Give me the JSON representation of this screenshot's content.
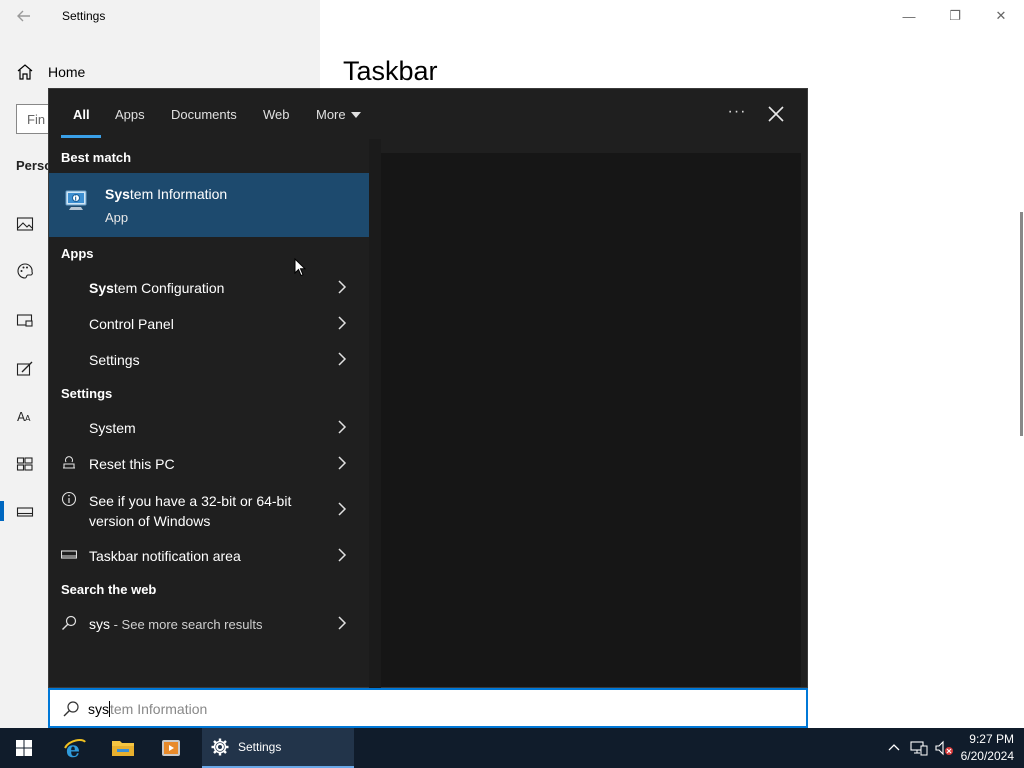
{
  "window": {
    "title": "Settings",
    "back_icon": "back-arrow-icon",
    "controls": {
      "minimize": "—",
      "maximize": "❐",
      "close": "✕"
    }
  },
  "sidebar": {
    "home_label": "Home",
    "find_placeholder": "Fin",
    "section_label": "Perso",
    "icons": [
      "picture-icon",
      "palette-icon",
      "lock-screen-icon",
      "themes-icon",
      "font-icon",
      "start-icon",
      "taskbar-icon"
    ]
  },
  "main": {
    "heading": "Taskbar"
  },
  "search": {
    "tabs": [
      {
        "label": "All",
        "active": true
      },
      {
        "label": "Apps"
      },
      {
        "label": "Documents"
      },
      {
        "label": "Web"
      },
      {
        "label": "More"
      }
    ],
    "more_options": "···",
    "best_match_header": "Best match",
    "best_match": {
      "title_bold": "Sys",
      "title_rest": "tem Information",
      "subtitle": "App"
    },
    "apps_header": "Apps",
    "apps": [
      {
        "bold": "Sys",
        "rest": "tem Configuration"
      },
      {
        "bold": "",
        "rest": "Control Panel"
      },
      {
        "bold": "",
        "rest": "Settings"
      }
    ],
    "settings_header": "Settings",
    "settings": [
      {
        "label": "System",
        "icon": ""
      },
      {
        "label": "Reset this PC",
        "icon": "reset-icon"
      },
      {
        "label_line1": "See if you have a 32-bit or 64-bit",
        "label_line2": "version of Windows",
        "icon": "info-icon"
      },
      {
        "label": "Taskbar notification area",
        "icon": "taskbar-icon"
      }
    ],
    "web_header": "Search the web",
    "web": {
      "query": "sys",
      "suffix": " - See more search results"
    },
    "input": {
      "typed": "sys",
      "suggestion": "tem Information"
    }
  },
  "taskbar": {
    "apps": [
      "start-icon",
      "internet-explorer-icon",
      "file-explorer-icon",
      "media-player-icon"
    ],
    "active_app": "Settings",
    "time": "9:27 PM",
    "date": "6/20/2024"
  }
}
